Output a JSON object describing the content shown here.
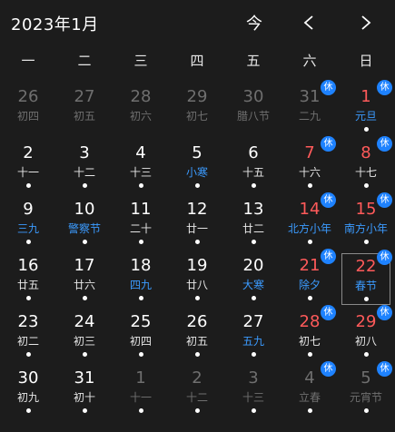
{
  "header": {
    "month_title": "2023年1月",
    "today_label": "今"
  },
  "weekdays": [
    "一",
    "二",
    "三",
    "四",
    "五",
    "六",
    "日"
  ],
  "badge_text": "休",
  "colors": {
    "background": "#1c1c1c",
    "weekend_red": "#ff5a5a",
    "festival_blue": "#3b9bff",
    "badge_blue": "#1e82ff",
    "other_month_gray": "#6f6f6f"
  },
  "days": [
    {
      "day": "26",
      "sub": "初四",
      "other": true,
      "dot": false
    },
    {
      "day": "27",
      "sub": "初五",
      "other": true,
      "dot": false
    },
    {
      "day": "28",
      "sub": "初六",
      "other": true,
      "dot": false
    },
    {
      "day": "29",
      "sub": "初七",
      "other": true,
      "dot": false
    },
    {
      "day": "30",
      "sub": "腊八节",
      "other": true,
      "dot": false
    },
    {
      "day": "31",
      "sub": "二九",
      "other": true,
      "weekend": true,
      "badge": true,
      "dot": false
    },
    {
      "day": "1",
      "sub": "元旦",
      "weekend": true,
      "festival": true,
      "badge": true,
      "dot": true
    },
    {
      "day": "2",
      "sub": "十一",
      "dot": true
    },
    {
      "day": "3",
      "sub": "十二",
      "dot": true
    },
    {
      "day": "4",
      "sub": "十三",
      "dot": true
    },
    {
      "day": "5",
      "sub": "小寒",
      "festival": true,
      "dot": true
    },
    {
      "day": "6",
      "sub": "十五",
      "dot": true
    },
    {
      "day": "7",
      "sub": "十六",
      "weekend": true,
      "badge": true,
      "dot": true
    },
    {
      "day": "8",
      "sub": "十七",
      "weekend": true,
      "badge": true,
      "dot": true
    },
    {
      "day": "9",
      "sub": "三九",
      "festival": true,
      "dot": true
    },
    {
      "day": "10",
      "sub": "警察节",
      "festival": true,
      "dot": true
    },
    {
      "day": "11",
      "sub": "二十",
      "dot": true
    },
    {
      "day": "12",
      "sub": "廿一",
      "dot": true
    },
    {
      "day": "13",
      "sub": "廿二",
      "dot": true
    },
    {
      "day": "14",
      "sub": "北方小年",
      "weekend": true,
      "festival": true,
      "badge": true,
      "dot": true
    },
    {
      "day": "15",
      "sub": "南方小年",
      "weekend": true,
      "festival": true,
      "badge": true,
      "dot": true
    },
    {
      "day": "16",
      "sub": "廿五",
      "dot": true
    },
    {
      "day": "17",
      "sub": "廿六",
      "dot": true
    },
    {
      "day": "18",
      "sub": "四九",
      "festival": true,
      "dot": true
    },
    {
      "day": "19",
      "sub": "廿八",
      "dot": true
    },
    {
      "day": "20",
      "sub": "大寒",
      "festival": true,
      "dot": true
    },
    {
      "day": "21",
      "sub": "除夕",
      "weekend": true,
      "festival": true,
      "badge": true,
      "dot": true
    },
    {
      "day": "22",
      "sub": "春节",
      "weekend": true,
      "festival": true,
      "badge": true,
      "selected": true,
      "dot": true
    },
    {
      "day": "23",
      "sub": "初二",
      "dot": true
    },
    {
      "day": "24",
      "sub": "初三",
      "dot": true
    },
    {
      "day": "25",
      "sub": "初四",
      "dot": true
    },
    {
      "day": "26",
      "sub": "初五",
      "dot": true
    },
    {
      "day": "27",
      "sub": "五九",
      "festival": true,
      "dot": true
    },
    {
      "day": "28",
      "sub": "初七",
      "weekend": true,
      "badge": true,
      "dot": true
    },
    {
      "day": "29",
      "sub": "初八",
      "weekend": true,
      "badge": true,
      "dot": true
    },
    {
      "day": "30",
      "sub": "初九",
      "dot": true
    },
    {
      "day": "31",
      "sub": "初十",
      "dot": true
    },
    {
      "day": "1",
      "sub": "十一",
      "other": true,
      "dot": true
    },
    {
      "day": "2",
      "sub": "十二",
      "other": true,
      "dot": true
    },
    {
      "day": "3",
      "sub": "十三",
      "other": true,
      "dot": true
    },
    {
      "day": "4",
      "sub": "立春",
      "other": true,
      "weekend": true,
      "badge": true,
      "dot": true
    },
    {
      "day": "5",
      "sub": "元宵节",
      "other": true,
      "weekend": true,
      "badge": true,
      "dot": true
    }
  ]
}
